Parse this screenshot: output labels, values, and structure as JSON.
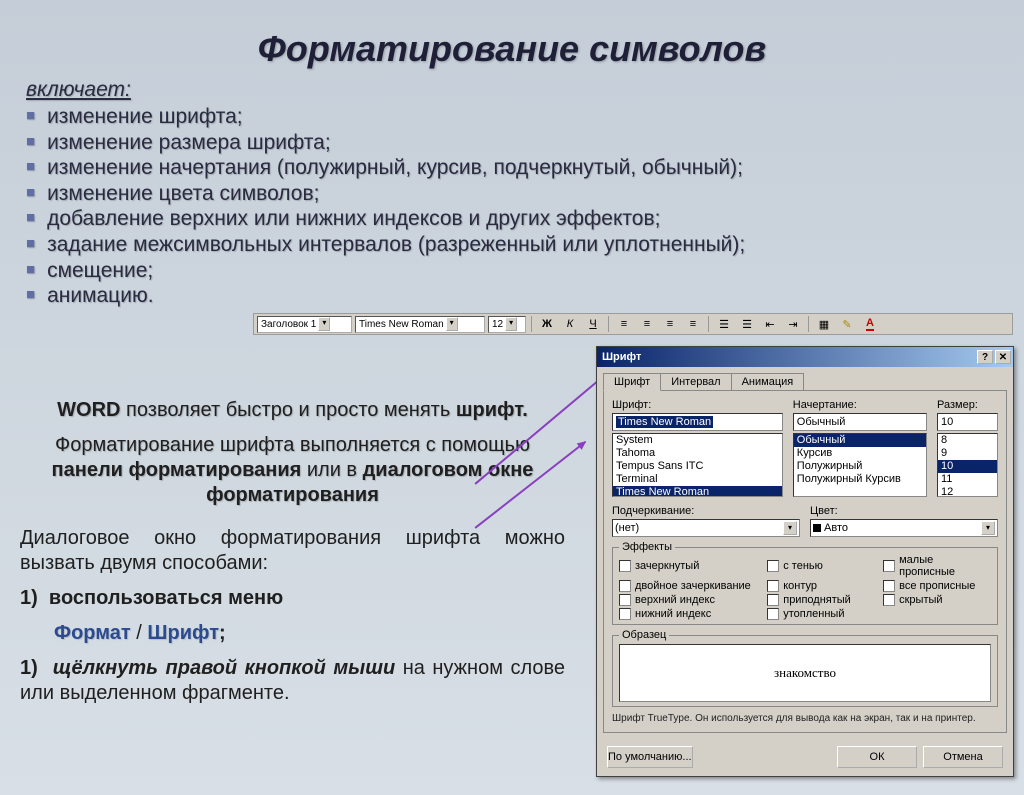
{
  "title": "Форматирование символов",
  "intro": "включает:",
  "bullets": [
    "изменение шрифта;",
    "изменение размера шрифта;",
    "изменение начертания (полужирный, курсив, подчеркнутый, обычный);",
    "изменение цвета символов;",
    "добавление верхних или нижних индексов и других эффектов;",
    "задание межсимвольных интервалов (разреженный или уплотненный);",
    "смещение;",
    "анимацию."
  ],
  "para": {
    "p1a": "WORD",
    "p1b": " позволяет быстро и просто менять ",
    "p1c": "шрифт.",
    "p2a": "Форматирование шрифта выполняется с помощью ",
    "p2b": "панели форматирования",
    "p2c": "     или в ",
    "p2d": "диалоговом окне форматирования",
    "p3": "Диалоговое окно форматирования шрифта можно вызвать двумя способами:",
    "li1": "воспользоваться меню",
    "li1a": "Формат",
    "li1b": " / ",
    "li1c": "Шрифт",
    "li1d": ";",
    "li2": "щёлкнуть правой кнопкой мыши",
    "li2a": " на нужном слове или выделенном фрагменте."
  },
  "toolbar": {
    "style": "Заголовок 1",
    "font": "Times New Roman",
    "size": "12",
    "bold": "Ж",
    "italic": "К",
    "underline": "Ч"
  },
  "dialog": {
    "title": "Шрифт",
    "tabs": [
      "Шрифт",
      "Интервал",
      "Анимация"
    ],
    "labels": {
      "font": "Шрифт:",
      "style": "Начертание:",
      "size": "Размер:",
      "underline": "Подчеркивание:",
      "color": "Цвет:",
      "effects": "Эффекты",
      "sample": "Образец"
    },
    "font_value": "Times New Roman",
    "font_list": [
      "System",
      "Tahoma",
      "Tempus Sans ITC",
      "Terminal",
      "Times New Roman"
    ],
    "style_value": "Обычный",
    "style_list": [
      "Обычный",
      "Курсив",
      "Полужирный",
      "Полужирный Курсив"
    ],
    "size_value": "10",
    "size_list": [
      "8",
      "9",
      "10",
      "11",
      "12"
    ],
    "underline_value": "(нет)",
    "color_value": "Авто",
    "effects": [
      "зачеркнутый",
      "с тенью",
      "малые прописные",
      "двойное зачеркивание",
      "контур",
      "все прописные",
      "верхний индекс",
      "приподнятый",
      "скрытый",
      "нижний индекс",
      "утопленный",
      ""
    ],
    "sample_text": "знакомство",
    "hint": "Шрифт TrueType. Он используется для вывода как на экран, так и на принтер.",
    "btn_default": "По умолчанию...",
    "btn_ok": "ОК",
    "btn_cancel": "Отмена"
  }
}
